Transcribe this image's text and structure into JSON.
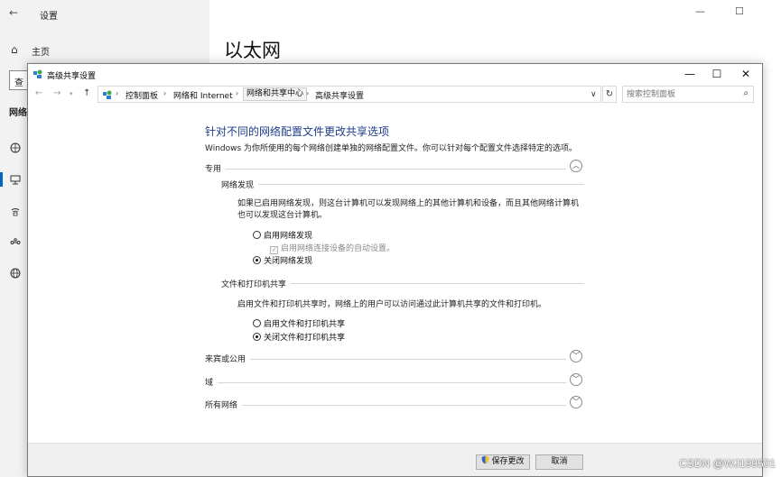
{
  "settings_window": {
    "title": "设置",
    "home_label": "主页",
    "search_fragment": "查",
    "section_fragment": "网络",
    "page_title": "以太网",
    "minimize": "—",
    "maximize": "☐",
    "close": "✕"
  },
  "cp_window": {
    "title": "高级共享设置",
    "minimize": "—",
    "maximize": "☐",
    "close": "✕",
    "breadcrumbs": [
      "控制面板",
      "网络和 Internet",
      "网络和共享中心",
      "高级共享设置"
    ],
    "search_placeholder": "搜索控制面板"
  },
  "content": {
    "heading": "针对不同的网络配置文件更改共享选项",
    "subtext": "Windows 为你所使用的每个网络创建单独的网络配置文件。你可以针对每个配置文件选择特定的选项。",
    "private": {
      "label": "专用",
      "discovery": {
        "label": "网络发现",
        "desc": "如果已启用网络发现，则这台计算机可以发现网络上的其他计算机和设备，而且其他网络计算机也可以发现这台计算机。",
        "opt_on": "启用网络发现",
        "auto_setup": "启用网络连接设备的自动设置。",
        "opt_off": "关闭网络发现",
        "selected": "opt_off"
      },
      "file_sharing": {
        "label": "文件和打印机共享",
        "desc": "启用文件和打印机共享时，网络上的用户可以访问通过此计算机共享的文件和打印机。",
        "opt_on": "启用文件和打印机共享",
        "opt_off": "关闭文件和打印机共享",
        "selected": "opt_off"
      }
    },
    "guest_public": {
      "label": "来宾或公用"
    },
    "domain": {
      "label": "域"
    },
    "all_networks": {
      "label": "所有网络"
    }
  },
  "footer": {
    "save_label": "保存更改",
    "cancel_label": "取消"
  },
  "watermark": "CSDN @WJ199501",
  "colors": {
    "heading": "#1e3d8a",
    "accent": "#0067c0"
  }
}
